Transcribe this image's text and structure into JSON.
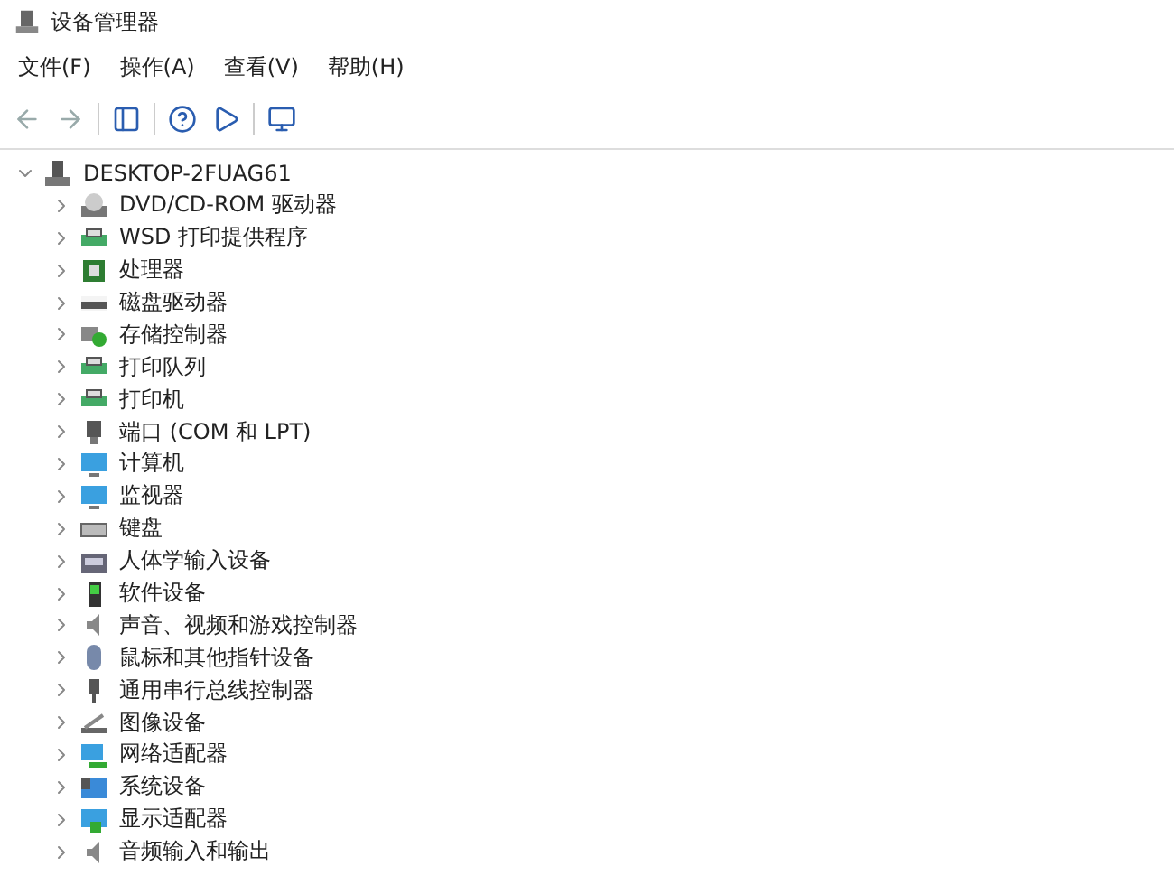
{
  "window": {
    "title": "设备管理器"
  },
  "menu": [
    "文件(F)",
    "操作(A)",
    "查看(V)",
    "帮助(H)"
  ],
  "tree": {
    "label": "DESKTOP-2FUAG61",
    "expanded": true,
    "children": [
      {
        "label": "DVD/CD-ROM 驱动器",
        "expanded": false
      },
      {
        "label": "WSD 打印提供程序",
        "expanded": false
      },
      {
        "label": "处理器",
        "expanded": false
      },
      {
        "label": "磁盘驱动器",
        "expanded": false
      },
      {
        "label": "存储控制器",
        "expanded": false
      },
      {
        "label": "打印队列",
        "expanded": false
      },
      {
        "label": "打印机",
        "expanded": false
      },
      {
        "label": "端口 (COM 和 LPT)",
        "expanded": false
      },
      {
        "label": "计算机",
        "expanded": false
      },
      {
        "label": "监视器",
        "expanded": false
      },
      {
        "label": "键盘",
        "expanded": false
      },
      {
        "label": "人体学输入设备",
        "expanded": false
      },
      {
        "label": "软件设备",
        "expanded": false
      },
      {
        "label": "声音、视频和游戏控制器",
        "expanded": false
      },
      {
        "label": "鼠标和其他指针设备",
        "expanded": false
      },
      {
        "label": "通用串行总线控制器",
        "expanded": false
      },
      {
        "label": "图像设备",
        "expanded": false
      },
      {
        "label": "网络适配器",
        "expanded": false
      },
      {
        "label": "系统设备",
        "expanded": false
      },
      {
        "label": "显示适配器",
        "expanded": false
      },
      {
        "label": "音频输入和输出",
        "expanded": false
      }
    ]
  }
}
